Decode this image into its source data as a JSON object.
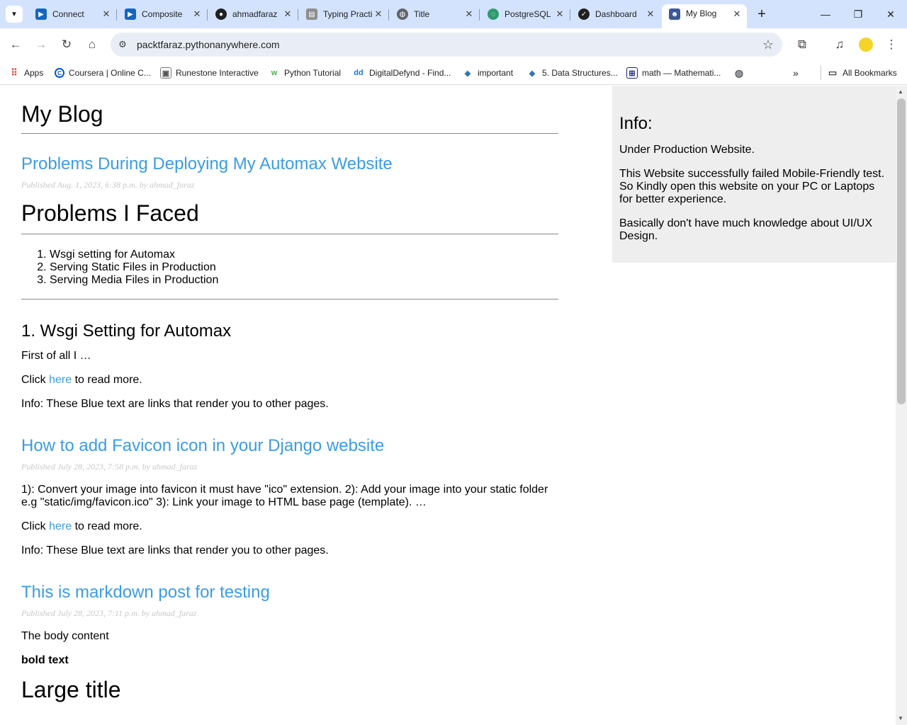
{
  "browser": {
    "tabs": [
      {
        "title": "Connect",
        "icon": "youtube-icon",
        "color": "#1565c0"
      },
      {
        "title": "Composite",
        "icon": "youtube-icon",
        "color": "#1565c0"
      },
      {
        "title": "ahmadfaraz",
        "icon": "github-icon",
        "color": "#1f1f1f"
      },
      {
        "title": "Typing Practice",
        "icon": "page-icon",
        "color": "#8d8d8d"
      },
      {
        "title": "Title",
        "icon": "globe-icon",
        "color": "#5f6368"
      },
      {
        "title": "PostgreSQL",
        "icon": "postgres-icon",
        "color": "#2e9b6f"
      },
      {
        "title": "Dashboard",
        "icon": "check-icon",
        "color": "#1f1f1f"
      },
      {
        "title": "My Blog",
        "icon": "avatar-icon",
        "color": "#3b5998"
      }
    ],
    "url": "packtfaraz.pythonanywhere.com",
    "bookmarks": [
      {
        "label": "Apps",
        "icon": "apps-grid-icon"
      },
      {
        "label": "Coursera | Online C...",
        "icon": "coursera-icon"
      },
      {
        "label": "Runestone Interactive",
        "icon": "runestone-icon"
      },
      {
        "label": "Python Tutorial",
        "icon": "w3-icon"
      },
      {
        "label": "DigitalDefynd - Find...",
        "icon": "dd-icon"
      },
      {
        "label": "important",
        "icon": "python-icon"
      },
      {
        "label": "5. Data Structures...",
        "icon": "python-icon"
      },
      {
        "label": "math — Mathemati...",
        "icon": "grid-icon"
      }
    ],
    "all_bookmarks": "All Bookmarks"
  },
  "blog": {
    "site_title": "My Blog",
    "posts": [
      {
        "title": "Problems During Deploying My Automax Website",
        "meta": "Published Aug. 1, 2023, 6:38 p.m. by ahmad_faraz"
      },
      {
        "title": "How to add Favicon icon in your Django website",
        "meta": "Published July 28, 2023, 7:58 p.m. by ahmad_faraz",
        "excerpt": "1): Convert your image into favicon it must have \"ico\" extension. 2): Add your image into your static folder e.g \"static/img/favicon.ico\" 3): Link your image to HTML base page (template). …"
      },
      {
        "title": "This is markdown post for testing",
        "meta": "Published July 28, 2023, 7:11 p.m. by ahmad_faraz",
        "body": "The body content",
        "bold": "bold text",
        "large": "Large title"
      }
    ],
    "post1": {
      "heading": "Problems I Faced",
      "list": [
        "Wsgi setting for Automax",
        "Serving Static Files in Production",
        "Serving Media Files in Production"
      ],
      "subheading": "1. Wsgi Setting for Automax",
      "excerpt": "First of all I …"
    },
    "click_prefix": "Click ",
    "click_link": "here",
    "click_suffix": " to read more.",
    "info_line": "Info: These Blue text are links that render you to other pages."
  },
  "sidebar": {
    "heading": "Info:",
    "paragraphs": [
      "Under Production Website.",
      "This Website successfully failed Mobile-Friendly test. So Kindly open this website on your PC or Laptops for better experience.",
      "Basically don't have much knowledge about UI/UX Design."
    ]
  }
}
